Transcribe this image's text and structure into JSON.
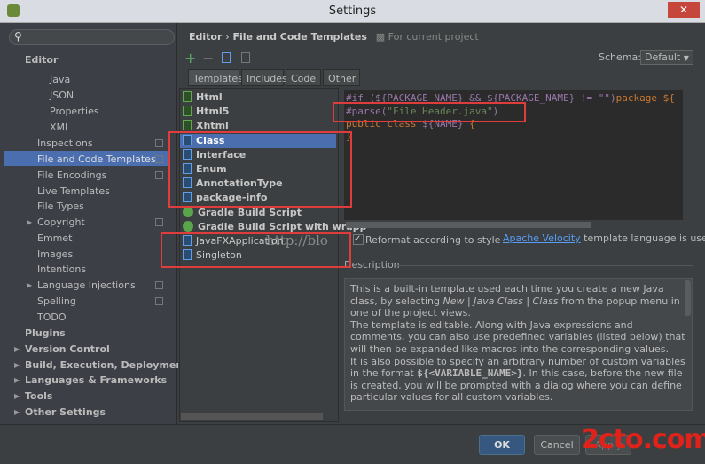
{
  "window": {
    "title": "Settings",
    "close": "✕"
  },
  "sidebar": {
    "search_placeholder": "",
    "items": [
      {
        "label": "Editor"
      },
      {
        "label": "Java"
      },
      {
        "label": "JSON"
      },
      {
        "label": "Properties"
      },
      {
        "label": "XML"
      },
      {
        "label": "Inspections"
      },
      {
        "label": "File and Code Templates"
      },
      {
        "label": "File Encodings"
      },
      {
        "label": "Live Templates"
      },
      {
        "label": "File Types"
      },
      {
        "label": "Copyright"
      },
      {
        "label": "Emmet"
      },
      {
        "label": "Images"
      },
      {
        "label": "Intentions"
      },
      {
        "label": "Language Injections"
      },
      {
        "label": "Spelling"
      },
      {
        "label": "TODO"
      },
      {
        "label": "Plugins"
      },
      {
        "label": "Version Control"
      },
      {
        "label": "Build, Execution, Deployment"
      },
      {
        "label": "Languages & Frameworks"
      },
      {
        "label": "Tools"
      },
      {
        "label": "Other Settings"
      }
    ],
    "selected": "File and Code Templates"
  },
  "header": {
    "breadcrumb_parent": "Editor",
    "separator": "›",
    "breadcrumb_current": "File and Code Templates",
    "scope": "For current project"
  },
  "schema": {
    "label": "Schema:",
    "value": "Default"
  },
  "tabs": [
    "Templates",
    "Includes",
    "Code",
    "Other"
  ],
  "active_tab": "Templates",
  "templates": [
    "Html",
    "Html5",
    "Xhtml",
    "Class",
    "Interface",
    "Enum",
    "AnnotationType",
    "package-info",
    "Gradle Build Script",
    "Gradle Build Script with wrapp",
    "JavaFXApplication",
    "Singleton"
  ],
  "selected_template": "Class",
  "editor": {
    "lines": [
      {
        "a": "#if (${PACKAGE_NAME} && ${PACKAGE_NAME} != \"\")",
        "b": "package ${"
      },
      {
        "a": "#parse(",
        "b": "\"File Header.java\"",
        "c": ")"
      },
      {
        "a": "public class ",
        "b": "${NAME}",
        "c": " {"
      },
      {
        "a": "}"
      }
    ]
  },
  "reformat": {
    "label": "Reformat according to style",
    "checked": true
  },
  "velocity": {
    "link": "Apache Velocity",
    "text": " template language is used"
  },
  "description": {
    "label": "Description",
    "p1a": "This is a built-in template used each time you create a new Java class, by selecting ",
    "p1b": "New | Java Class | Class",
    "p1c": " from the popup menu in one of the project views.",
    "p2": "The template is editable. Along with Java expressions and comments, you can also use predefined variables (listed below) that will then be expanded like macros into the corresponding values.",
    "p3a": "It is also possible to specify an arbitrary number of custom variables in the format ",
    "p3b": "${<VARIABLE_NAME>}",
    "p3c": ". In this case, before the new file is created, you will be prompted with a dialog where you can define particular values for all custom variables."
  },
  "buttons": {
    "ok": "OK",
    "cancel": "Cancel",
    "apply": "Apply"
  },
  "watermarks": {
    "url": "http://blo",
    "logo": "2cto.com"
  },
  "colors": {
    "selection": "#4b6eaf",
    "highlight_box": "#e03c3c",
    "keyword": "#cc7832",
    "string": "#6a8759",
    "link": "#589df6"
  }
}
